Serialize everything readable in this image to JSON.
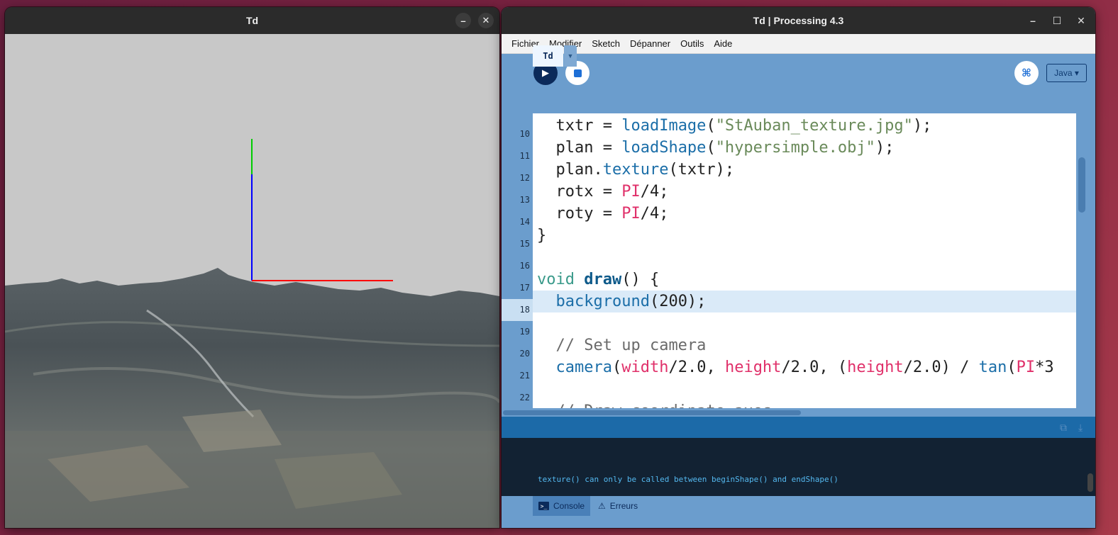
{
  "sketch_window": {
    "title": "Td",
    "minimize_label": "–",
    "close_label": "✕"
  },
  "ide_window": {
    "title": "Td | Processing 4.3",
    "minimize_label": "–",
    "maximize_label": "☐",
    "close_label": "✕"
  },
  "menu": [
    "Fichier",
    "Modifier",
    "Sketch",
    "Dépanner",
    "Outils",
    "Aide"
  ],
  "toolbar": {
    "run_icon": "play-icon",
    "stop_icon": "stop-icon",
    "debug_label": "⌘",
    "mode_label": "Java ▾"
  },
  "tabs": {
    "active": "Td",
    "menu_label": "▼"
  },
  "code": {
    "line_numbers": [
      "10",
      "11",
      "12",
      "13",
      "14",
      "15",
      "16",
      "17",
      "18",
      "19",
      "20",
      "21",
      "22"
    ],
    "current_line": "18"
  },
  "console": {
    "message": "texture() can only be called between beginShape() and endShape()",
    "tab_console": "Console",
    "tab_errors": "Erreurs"
  },
  "colors": {
    "ide_bg": "#6b9dcd",
    "console_bg": "#122233",
    "console_text": "#54b8ef",
    "axis_x": "#ff0000",
    "axis_y": "#00cc00",
    "axis_z": "#0000ff"
  }
}
